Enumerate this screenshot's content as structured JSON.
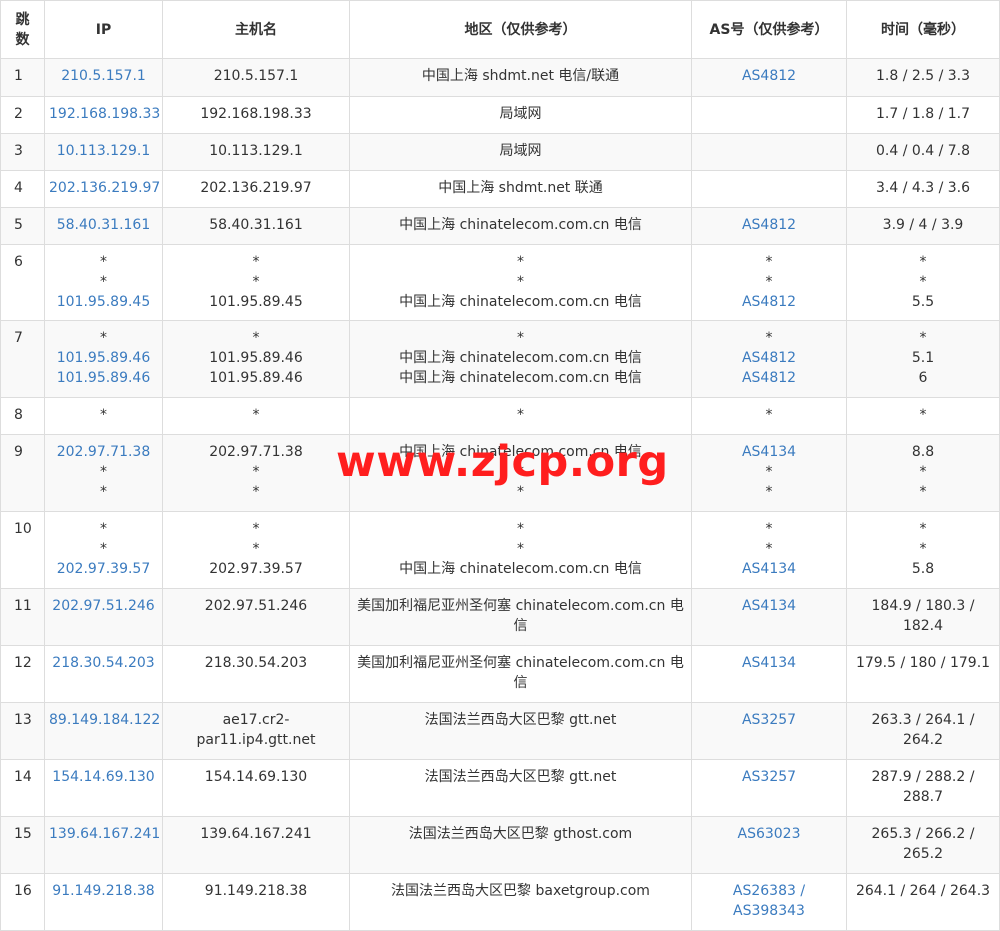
{
  "headers": [
    "跳数",
    "IP",
    "主机名",
    "地区（仅供参考）",
    "AS号（仅供参考）",
    "时间（毫秒）"
  ],
  "hops": [
    {
      "hop": "1",
      "ip": [
        "210.5.157.1"
      ],
      "host": [
        "210.5.157.1"
      ],
      "region": [
        "中国上海 shdmt.net 电信/联通"
      ],
      "asn": [
        "AS4812"
      ],
      "time": [
        "1.8 / 2.5 / 3.3"
      ]
    },
    {
      "hop": "2",
      "ip": [
        "192.168.198.33"
      ],
      "host": [
        "192.168.198.33"
      ],
      "region": [
        "局域网"
      ],
      "asn": [
        ""
      ],
      "time": [
        "1.7 / 1.8 / 1.7"
      ]
    },
    {
      "hop": "3",
      "ip": [
        "10.113.129.1"
      ],
      "host": [
        "10.113.129.1"
      ],
      "region": [
        "局域网"
      ],
      "asn": [
        ""
      ],
      "time": [
        "0.4 / 0.4 / 7.8"
      ]
    },
    {
      "hop": "4",
      "ip": [
        "202.136.219.97"
      ],
      "host": [
        "202.136.219.97"
      ],
      "region": [
        "中国上海 shdmt.net 联通"
      ],
      "asn": [
        ""
      ],
      "time": [
        "3.4 / 4.3 / 3.6"
      ]
    },
    {
      "hop": "5",
      "ip": [
        "58.40.31.161"
      ],
      "host": [
        "58.40.31.161"
      ],
      "region": [
        "中国上海 chinatelecom.com.cn 电信"
      ],
      "asn": [
        "AS4812"
      ],
      "time": [
        "3.9 / 4 / 3.9"
      ]
    },
    {
      "hop": "6",
      "ip": [
        "*",
        "*",
        "101.95.89.45"
      ],
      "host": [
        "*",
        "*",
        "101.95.89.45"
      ],
      "region": [
        "*",
        "*",
        "中国上海 chinatelecom.com.cn 电信"
      ],
      "asn": [
        "*",
        "*",
        "AS4812"
      ],
      "time": [
        "*",
        "*",
        "5.5"
      ]
    },
    {
      "hop": "7",
      "ip": [
        "*",
        "101.95.89.46",
        "101.95.89.46"
      ],
      "host": [
        "*",
        "101.95.89.46",
        "101.95.89.46"
      ],
      "region": [
        "*",
        "中国上海 chinatelecom.com.cn 电信",
        "中国上海 chinatelecom.com.cn 电信"
      ],
      "asn": [
        "*",
        "AS4812",
        "AS4812"
      ],
      "time": [
        "*",
        "5.1",
        "6"
      ]
    },
    {
      "hop": "8",
      "ip": [
        "*"
      ],
      "host": [
        "*"
      ],
      "region": [
        "*"
      ],
      "asn": [
        "*"
      ],
      "time": [
        "*"
      ]
    },
    {
      "hop": "9",
      "ip": [
        "202.97.71.38",
        "*",
        "*"
      ],
      "host": [
        "202.97.71.38",
        "*",
        "*"
      ],
      "region": [
        "中国上海 chinatelecom.com.cn 电信",
        "*",
        "*"
      ],
      "asn": [
        "AS4134",
        "*",
        "*"
      ],
      "time": [
        "8.8",
        "*",
        "*"
      ]
    },
    {
      "hop": "10",
      "ip": [
        "*",
        "*",
        "202.97.39.57"
      ],
      "host": [
        "*",
        "*",
        "202.97.39.57"
      ],
      "region": [
        "*",
        "*",
        "中国上海 chinatelecom.com.cn 电信"
      ],
      "asn": [
        "*",
        "*",
        "AS4134"
      ],
      "time": [
        "*",
        "*",
        "5.8"
      ]
    },
    {
      "hop": "11",
      "ip": [
        "202.97.51.246"
      ],
      "host": [
        "202.97.51.246"
      ],
      "region": [
        "美国加利福尼亚州圣何塞 chinatelecom.com.cn 电",
        "信"
      ],
      "asn": [
        "AS4134"
      ],
      "time": [
        "184.9 / 180.3 /",
        "182.4"
      ]
    },
    {
      "hop": "12",
      "ip": [
        "218.30.54.203"
      ],
      "host": [
        "218.30.54.203"
      ],
      "region": [
        "美国加利福尼亚州圣何塞 chinatelecom.com.cn 电",
        "信"
      ],
      "asn": [
        "AS4134"
      ],
      "time": [
        "179.5 / 180 / 179.1"
      ]
    },
    {
      "hop": "13",
      "ip": [
        "89.149.184.122"
      ],
      "host": [
        "ae17.cr2-",
        "par11.ip4.gtt.net"
      ],
      "region": [
        "法国法兰西岛大区巴黎 gtt.net"
      ],
      "asn": [
        "AS3257"
      ],
      "time": [
        "263.3 / 264.1 /",
        "264.2"
      ]
    },
    {
      "hop": "14",
      "ip": [
        "154.14.69.130"
      ],
      "host": [
        "154.14.69.130"
      ],
      "region": [
        "法国法兰西岛大区巴黎 gtt.net"
      ],
      "asn": [
        "AS3257"
      ],
      "time": [
        "287.9 / 288.2 /",
        "288.7"
      ]
    },
    {
      "hop": "15",
      "ip": [
        "139.64.167.241"
      ],
      "host": [
        "139.64.167.241"
      ],
      "region": [
        "法国法兰西岛大区巴黎 gthost.com"
      ],
      "asn": [
        "AS63023"
      ],
      "time": [
        "265.3 / 266.2 /",
        "265.2"
      ]
    },
    {
      "hop": "16",
      "ip": [
        "91.149.218.38"
      ],
      "host": [
        "91.149.218.38"
      ],
      "region": [
        "法国法兰西岛大区巴黎 baxetgroup.com"
      ],
      "asn": [
        "AS26383 /",
        "AS398343"
      ],
      "time": [
        "264.1 / 264 / 264.3"
      ]
    }
  ],
  "watermark": "www.zjcp.org",
  "colors": {
    "link": "#3b7bbf",
    "watermark": "#ff1e1e",
    "border": "#dddddd",
    "stripe": "#f9f9f9"
  }
}
